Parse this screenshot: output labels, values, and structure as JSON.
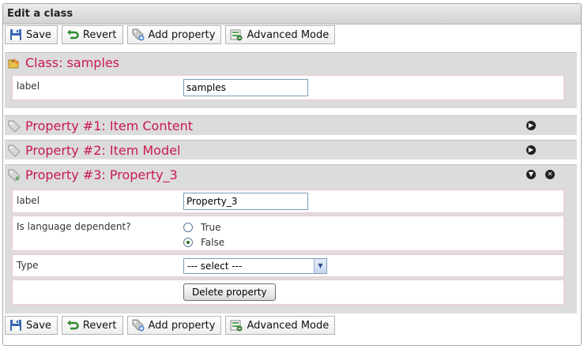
{
  "panel": {
    "title": "Edit a class"
  },
  "toolbar": {
    "save": "Save",
    "revert": "Revert",
    "add_property": "Add property",
    "advanced_mode": "Advanced Mode"
  },
  "class_section": {
    "title": "Class: samples",
    "label_field": {
      "label": "label",
      "value": "samples"
    }
  },
  "properties": [
    {
      "title": "Property #1: Item Content",
      "expanded": false
    },
    {
      "title": "Property #2: Item Model",
      "expanded": false
    },
    {
      "title": "Property #3: Property_3",
      "expanded": true,
      "label_field": {
        "label": "label",
        "value": "Property_3"
      },
      "language_dependent": {
        "label": "Is language dependent?",
        "options": [
          "True",
          "False"
        ],
        "selected": "False"
      },
      "type": {
        "label": "Type",
        "selected": "--- select ---"
      },
      "delete_label": "Delete property"
    }
  ],
  "colors": {
    "section_title": "#c9194d",
    "section_bg": "#dcdcdc",
    "row_border": "#f0c7d3"
  }
}
